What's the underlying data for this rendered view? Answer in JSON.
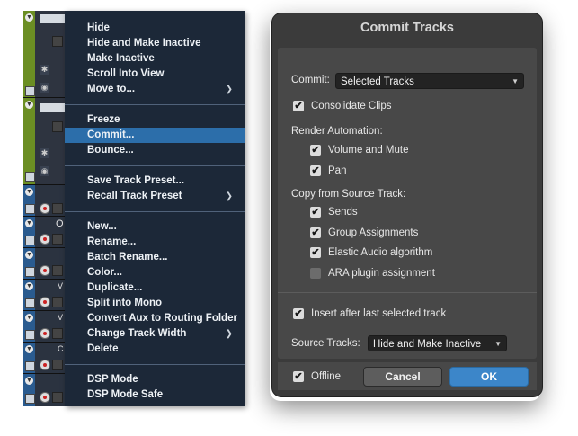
{
  "menu": {
    "items": [
      {
        "label": "Hide",
        "sub": ""
      },
      {
        "label": "Hide and Make Inactive",
        "sub": ""
      },
      {
        "label": "Make Inactive",
        "sub": ""
      },
      {
        "label": "Scroll Into View",
        "sub": ""
      },
      {
        "label": "Move to...",
        "sub": "❯"
      },
      {
        "label": "Freeze",
        "sub": ""
      },
      {
        "label": "Commit...",
        "sub": ""
      },
      {
        "label": "Bounce...",
        "sub": ""
      },
      {
        "label": "Save Track Preset...",
        "sub": ""
      },
      {
        "label": "Recall Track Preset",
        "sub": "❯"
      },
      {
        "label": "New...",
        "sub": ""
      },
      {
        "label": "Rename...",
        "sub": ""
      },
      {
        "label": "Batch Rename...",
        "sub": ""
      },
      {
        "label": "Color...",
        "sub": ""
      },
      {
        "label": "Duplicate...",
        "sub": ""
      },
      {
        "label": "Split into Mono",
        "sub": ""
      },
      {
        "label": "Convert Aux to Routing Folder",
        "sub": ""
      },
      {
        "label": "Change Track Width",
        "sub": "❯"
      },
      {
        "label": "Delete",
        "sub": ""
      },
      {
        "label": "DSP Mode",
        "sub": ""
      },
      {
        "label": "DSP Mode Safe",
        "sub": ""
      }
    ],
    "highlighted": "Commit...",
    "colors": {
      "background": "#1c2838",
      "highlight": "#2c6eaa",
      "text": "#eef2f6"
    }
  },
  "tracks": {
    "instrument_colors": [
      "#6b8e23",
      "#6b8e23"
    ],
    "audio_color": "#2a5b8f",
    "track_letter": "O",
    "track_letter_2": "V",
    "track_letter_3": "C"
  },
  "dialog": {
    "title": "Commit Tracks",
    "commit_label": "Commit:",
    "commit_value": "Selected Tracks",
    "consolidate_clips": {
      "label": "Consolidate Clips",
      "checked": true
    },
    "render_automation_label": "Render Automation:",
    "volume_and_mute": {
      "label": "Volume and Mute",
      "checked": true
    },
    "pan": {
      "label": "Pan",
      "checked": true
    },
    "copy_from_label": "Copy from Source Track:",
    "sends": {
      "label": "Sends",
      "checked": true
    },
    "group_assignments": {
      "label": "Group Assignments",
      "checked": true
    },
    "elastic_audio": {
      "label": "Elastic Audio algorithm",
      "checked": true
    },
    "ara_plugin": {
      "label": "ARA plugin assignment",
      "checked": false
    },
    "insert_after": {
      "label": "Insert after last selected track",
      "checked": true
    },
    "source_tracks_label": "Source Tracks:",
    "source_tracks_value": "Hide and Make Inactive",
    "offline": {
      "label": "Offline",
      "checked": true
    },
    "cancel_label": "Cancel",
    "ok_label": "OK",
    "check_glyph": "✔",
    "caret_glyph": "▼",
    "colors": {
      "dialog_bg": "#3b3b3b",
      "panel_bg": "#484848",
      "ok_button": "#3c86c9"
    }
  }
}
